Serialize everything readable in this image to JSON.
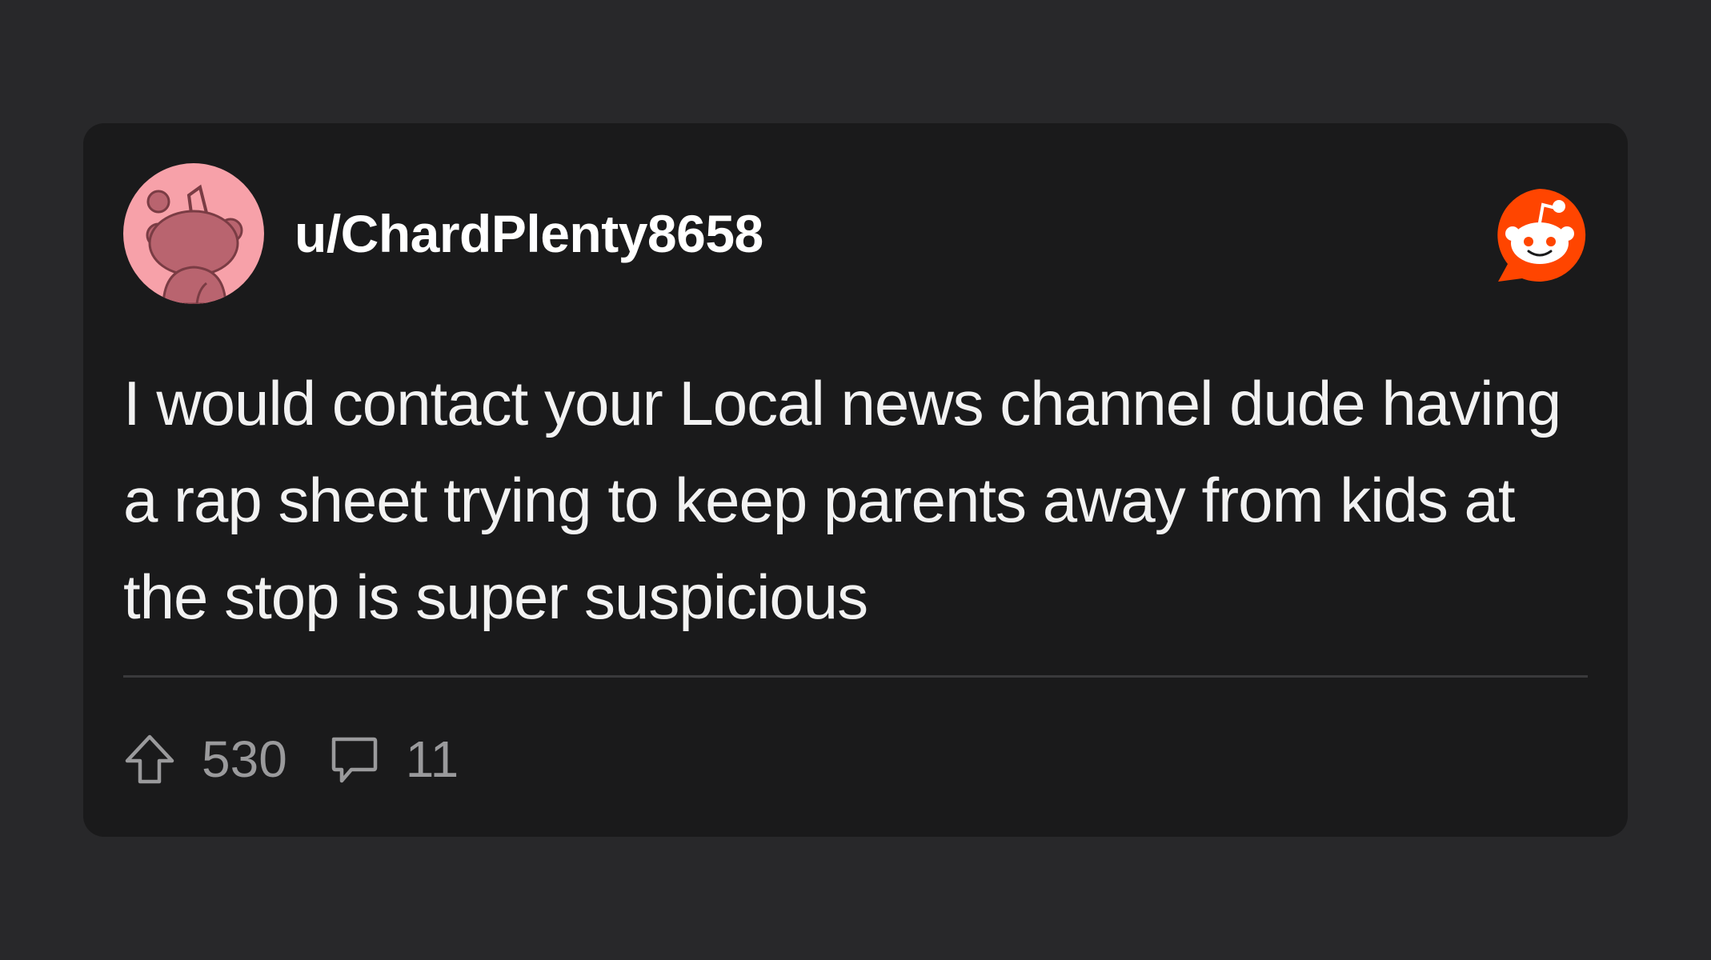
{
  "post": {
    "username": "u/ChardPlenty8658",
    "avatar_icon": "snoo-avatar-icon",
    "brand_icon": "reddit-logo-icon",
    "body": "I would contact your Local news channel dude having a rap sheet trying to keep parents away from kids at the stop is super suspicious",
    "upvotes": "530",
    "comments": "11"
  },
  "colors": {
    "page_background": "#28282a",
    "card_background": "#1a1a1b",
    "avatar_background": "#f7a1a9",
    "reddit_orange": "#ff4500",
    "text_primary": "#ffffff",
    "text_secondary": "#9a9a9c"
  }
}
